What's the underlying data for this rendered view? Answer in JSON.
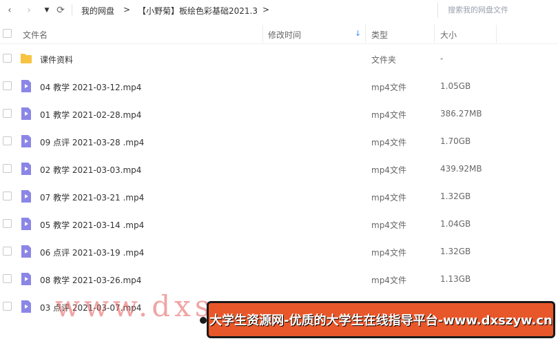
{
  "nav": {
    "back_glyph": "‹",
    "forward_glyph": "›",
    "dropdown_glyph": "▼",
    "refresh_glyph": "⟳",
    "breadcrumb": [
      "我的网盘",
      "【小野菊】板绘色彩基础2021.3"
    ],
    "crumb_arrow": ">",
    "search_placeholder": "搜索我的网盘文件"
  },
  "header": {
    "name": "文件名",
    "modified": "修改时间",
    "sort_glyph": "↓",
    "type": "类型",
    "size": "大小"
  },
  "colors": {
    "folder": "#f7c340",
    "video": "#8b86e6",
    "accent": "#3b8cff"
  },
  "files": [
    {
      "name": "课件资料",
      "type": "文件夹",
      "size": "-",
      "icon": "folder-icon"
    },
    {
      "name": "04 教学 2021-03-12.mp4",
      "type": "mp4文件",
      "size": "1.05GB",
      "icon": "video-file-icon"
    },
    {
      "name": "01 教学 2021-02-28.mp4",
      "type": "mp4文件",
      "size": "386.27MB",
      "icon": "video-file-icon"
    },
    {
      "name": "09 点评 2021-03-28 .mp4",
      "type": "mp4文件",
      "size": "1.70GB",
      "icon": "video-file-icon"
    },
    {
      "name": "02 教学 2021-03-03.mp4",
      "type": "mp4文件",
      "size": "439.92MB",
      "icon": "video-file-icon"
    },
    {
      "name": "07 教学 2021-03-21 .mp4",
      "type": "mp4文件",
      "size": "1.32GB",
      "icon": "video-file-icon"
    },
    {
      "name": "05 教学 2021-03-14 .mp4",
      "type": "mp4文件",
      "size": "1.04GB",
      "icon": "video-file-icon"
    },
    {
      "name": "06 点评 2021-03-19 .mp4",
      "type": "mp4文件",
      "size": "1.32GB",
      "icon": "video-file-icon"
    },
    {
      "name": "08 教学 2021-03-26.mp4",
      "type": "mp4文件",
      "size": "1.13GB",
      "icon": "video-file-icon"
    },
    {
      "name": "03 点评 2021-03-07.mp4",
      "type": "",
      "size": "",
      "icon": "video-file-icon"
    }
  ],
  "watermark": {
    "text": "www.dxsz",
    "banner": "大学生资源网-优质的大学生在线指导平台-www.dxszyw.cn"
  }
}
